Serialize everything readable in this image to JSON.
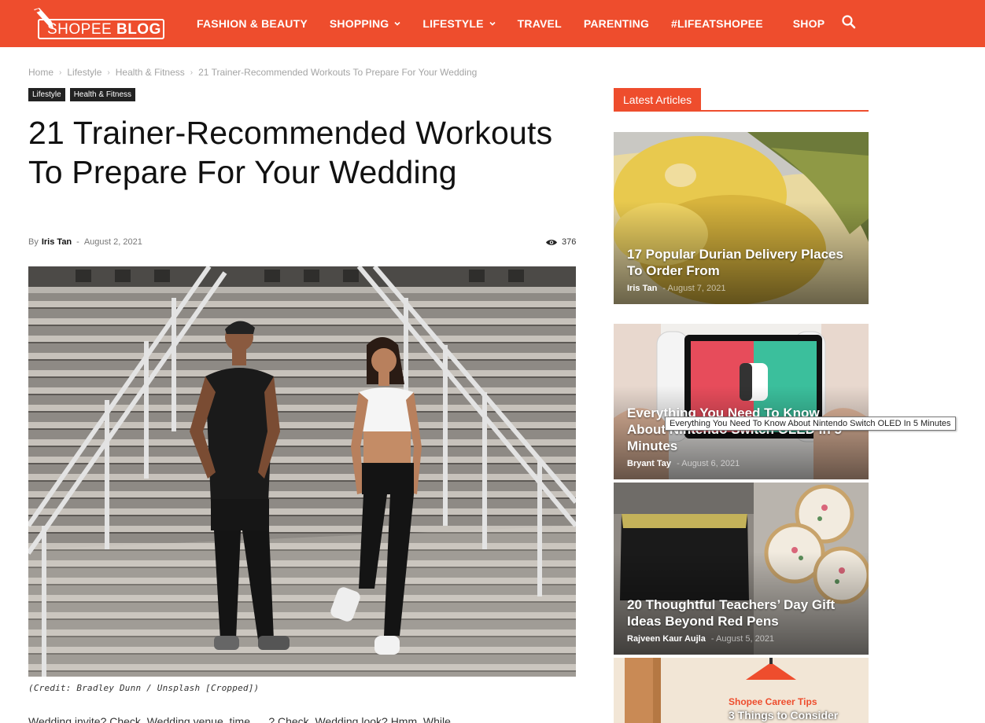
{
  "brand": {
    "logo_word1": "SHOPEE",
    "logo_word2": "BLOG",
    "color": "#ee4d2d"
  },
  "nav": {
    "items": [
      {
        "label": "FASHION & BEAUTY",
        "dropdown": false
      },
      {
        "label": "SHOPPING",
        "dropdown": true
      },
      {
        "label": "LIFESTYLE",
        "dropdown": true
      },
      {
        "label": "TRAVEL",
        "dropdown": false
      },
      {
        "label": "PARENTING",
        "dropdown": false
      },
      {
        "label": "#LIFEATSHOPEE",
        "dropdown": false
      },
      {
        "label": "SHOP",
        "dropdown": false
      }
    ],
    "search_icon": "search-icon"
  },
  "breadcrumb": [
    "Home",
    "Lifestyle",
    "Health & Fitness",
    "21 Trainer-Recommended Workouts To Prepare For Your Wedding"
  ],
  "tags": [
    "Lifestyle",
    "Health & Fitness"
  ],
  "article": {
    "title": "21 Trainer-Recommended Workouts To Prepare For Your Wedding",
    "by": "By",
    "author": "Iris Tan",
    "date": "August 2, 2021",
    "views": "376",
    "caption": "(Credit: Bradley Dunn / Unsplash [Cropped])",
    "body_peek": "Wedding invite? Check. Wedding venue, time, ... ? Check. Wedding look? Hmm. While..."
  },
  "sidebar": {
    "heading": "Latest Articles",
    "cards": [
      {
        "title": "17 Popular Durian Delivery Places To Order From",
        "author": "Iris Tan",
        "date": "August 7, 2021",
        "image": "durian"
      },
      {
        "title": "Everything You Need To Know About Nintendo Switch OLED In 5 Minutes",
        "author": "Bryant Tay",
        "date": "August 6, 2021",
        "image": "switch"
      },
      {
        "title": "20 Thoughtful Teachers’ Day Gift Ideas Beyond Red Pens",
        "author": "Rajveen Kaur Aujla",
        "date": "August 5, 2021",
        "image": "gifts"
      },
      {
        "title": "Shopee Career Tips",
        "subtitle": "3 Things to Consider",
        "image": "career"
      }
    ],
    "tooltip": "Everything You Need To Know About Nintendo Switch OLED In 5 Minutes"
  }
}
